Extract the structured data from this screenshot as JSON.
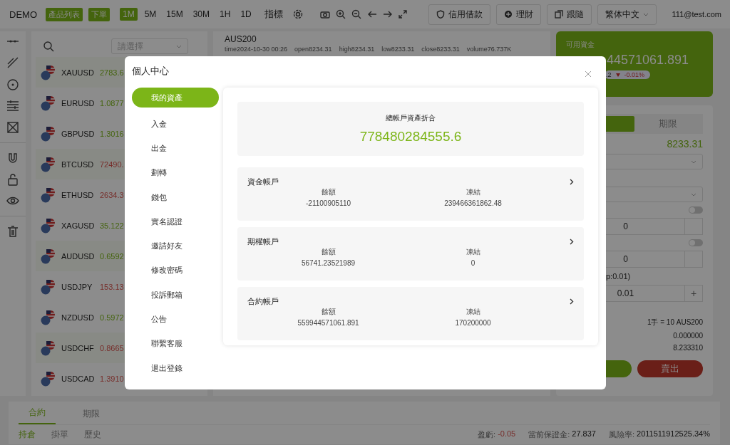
{
  "top_bar": {
    "brand": "DEMO",
    "nav_buttons": [
      "產品列表",
      "下單"
    ],
    "intervals": [
      {
        "label": "1M",
        "selected": true
      },
      {
        "label": "5M",
        "selected": false
      },
      {
        "label": "15M",
        "selected": false
      },
      {
        "label": "30M",
        "selected": false
      },
      {
        "label": "1H",
        "selected": false
      },
      {
        "label": "1D",
        "selected": false
      }
    ],
    "indicator_label": "指標",
    "actions": [
      "信用借款",
      "理財",
      "跟隨"
    ],
    "language": "繁体中文",
    "account": "111@test.com"
  },
  "symbol_list": {
    "placeholder": "請選擇",
    "items": [
      {
        "symbol": "XAUUSD",
        "price": "2783.6",
        "color": "#44640d"
      },
      {
        "symbol": "EURUSD",
        "price": "1.0877",
        "color": "#44640d"
      },
      {
        "symbol": "GBPUSD",
        "price": "1.3016",
        "color": "#44640d"
      },
      {
        "symbol": "BTCUSD",
        "price": "72490.",
        "color": "#772e2b"
      },
      {
        "symbol": "ETHUSD",
        "price": "2634.3",
        "color": "#772e2b"
      },
      {
        "symbol": "XAGUSD",
        "price": "35.122",
        "color": "#44640d"
      },
      {
        "symbol": "AUDUSD",
        "price": "0.6592",
        "color": "#44640d"
      },
      {
        "symbol": "USDJPY",
        "price": "153.13",
        "color": "#772e2b"
      },
      {
        "symbol": "NZDUSD",
        "price": "0.5972",
        "color": "#44640d"
      },
      {
        "symbol": "USDCHF",
        "price": "0.8665",
        "color": "#772e2b"
      },
      {
        "symbol": "USDCAD",
        "price": "1.3910",
        "color": "#772e2b"
      }
    ]
  },
  "chart_header": {
    "symbol": "AUS200",
    "stats": [
      "time2024-10-30 00:26",
      "open8234.31",
      "high8234.31",
      "low8233.31",
      "close8233.31",
      "volume76.737K"
    ]
  },
  "trade_panel": {
    "balance_label": "可用資金",
    "balance": "44571061.891",
    "change": ".2",
    "change_percent": "-0.01%",
    "tabs": [
      {
        "selected": true
      },
      {
        "label": "期限",
        "selected": false
      }
    ],
    "price": "8233.31",
    "toggles": [
      {
        "on": false
      },
      {
        "on": false
      }
    ],
    "stop_values": [
      "0",
      "0"
    ],
    "lot_hint": "p:0.01)",
    "lot": "0.01",
    "plus": "+",
    "info": [
      "1手 = 10 AUS200",
      "0.000000",
      "8.233310"
    ],
    "sell": "賣出"
  },
  "bottom": {
    "tabs": [
      {
        "label": "合約",
        "selected": true
      },
      {
        "label": "期限",
        "selected": false
      }
    ],
    "subtabs": [
      {
        "label": "持倉",
        "selected": true
      },
      {
        "label": "掛單",
        "selected": false
      },
      {
        "label": "歷史",
        "selected": false
      }
    ],
    "stats": [
      {
        "label": "盈虧:",
        "value": "-0.05",
        "color": "#772e2b"
      },
      {
        "label": "當前保證金:",
        "value": "27.837",
        "color": "#131313"
      },
      {
        "label": "風險率:",
        "value": "2011511912525.34%",
        "color": "#131313"
      }
    ]
  },
  "modal": {
    "title": "個人中心",
    "menu": [
      {
        "label": "我的資產",
        "selected": true
      },
      {
        "label": "入金",
        "selected": false
      },
      {
        "label": "出金",
        "selected": false
      },
      {
        "label": "劃轉",
        "selected": false
      },
      {
        "label": "錢包",
        "selected": false
      },
      {
        "label": "實名認證",
        "selected": false
      },
      {
        "label": "邀請好友",
        "selected": false
      },
      {
        "label": "修改密碼",
        "selected": false
      },
      {
        "label": "投訴郵箱",
        "selected": false
      },
      {
        "label": "公告",
        "selected": false
      },
      {
        "label": "聯繫客服",
        "selected": false
      },
      {
        "label": "退出登錄",
        "selected": false
      }
    ],
    "total_label": "總帳戶資產折合",
    "total": "778480284555.6",
    "accounts": [
      {
        "name": "資金帳戶",
        "balance_label": "餘額",
        "balance": "-21100905110",
        "frozen_label": "凍結",
        "frozen": "239466361862.48"
      },
      {
        "name": "期權帳戶",
        "balance_label": "餘額",
        "balance": "56741.23521989",
        "frozen_label": "凍結",
        "frozen": "0"
      },
      {
        "name": "合約帳戶",
        "balance_label": "餘額",
        "balance": "559944571061.891",
        "frozen_label": "凍結",
        "frozen": "170200000"
      }
    ]
  }
}
